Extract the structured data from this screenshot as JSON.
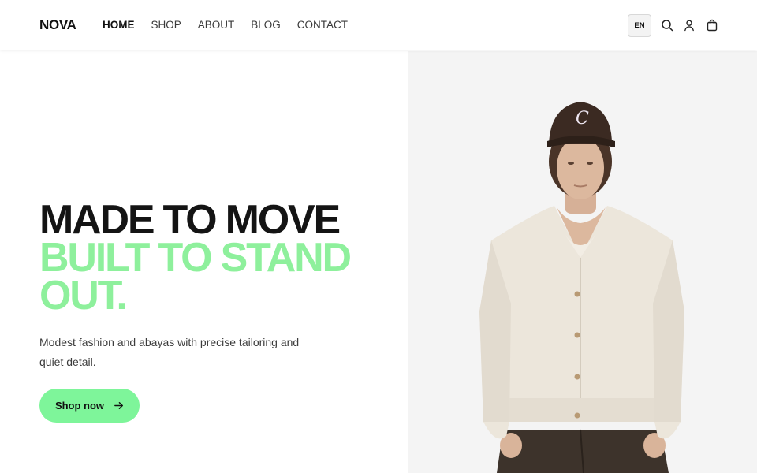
{
  "brand": {
    "logo": "NOVA"
  },
  "nav": {
    "items": [
      {
        "label": "HOME",
        "active": true
      },
      {
        "label": "SHOP",
        "active": false
      },
      {
        "label": "ABOUT",
        "active": false
      },
      {
        "label": "BLOG",
        "active": false
      },
      {
        "label": "CONTACT",
        "active": false
      }
    ]
  },
  "header_actions": {
    "language": "EN",
    "icons": [
      "search-icon",
      "user-icon",
      "cart-icon"
    ]
  },
  "hero": {
    "headline_line1": "MADE TO MOVE",
    "headline_line2": "BUILT TO STAND",
    "headline_line3": "OUT.",
    "subtext": "Modest fashion and abayas with precise tailoring and quiet detail.",
    "cta_label": "Shop now",
    "cta_icon": "arrow-right-icon",
    "image": "model-photo"
  },
  "colors": {
    "accent_green": "#8ef09c",
    "button_green": "#7ef59a",
    "headline_dark": "#141414",
    "image_panel_bg": "#f4f4f4"
  }
}
